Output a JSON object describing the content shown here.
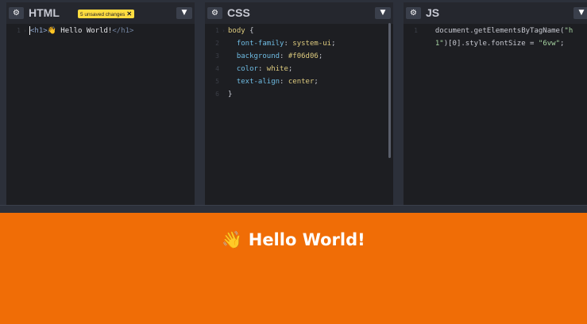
{
  "panes": {
    "html": {
      "title": "HTML",
      "badge": "5 unsaved changes",
      "badge_close": "✕",
      "lines": [
        {
          "num": "1",
          "open": "<h1>",
          "text": "👋 Hello World!",
          "close": "</h1>"
        }
      ]
    },
    "css": {
      "title": "CSS",
      "lines": [
        {
          "num": "1",
          "selector": "body",
          "brace": " {"
        },
        {
          "num": "2",
          "prop": "font-family",
          "value": "system-ui"
        },
        {
          "num": "3",
          "prop": "background",
          "value": "#f06d06"
        },
        {
          "num": "4",
          "prop": "color",
          "value": "white"
        },
        {
          "num": "5",
          "prop": "text-align",
          "value": "center"
        },
        {
          "num": "6",
          "brace": "}"
        }
      ]
    },
    "js": {
      "title": "JS",
      "lines": [
        {
          "num": "1",
          "a": "document.getElementsByTagName(",
          "b": "\"h"
        },
        {
          "num": "",
          "c": "1\"",
          "d": ")[0].style.fontSize = ",
          "e": "\"6vw\"",
          "f": ";"
        }
      ]
    }
  },
  "icons": {
    "settings": "gear-icon",
    "collapse": "chevron-down-icon"
  },
  "preview": {
    "heading": "👋 Hello World!",
    "background": "#f06d06",
    "color": "#ffffff"
  }
}
